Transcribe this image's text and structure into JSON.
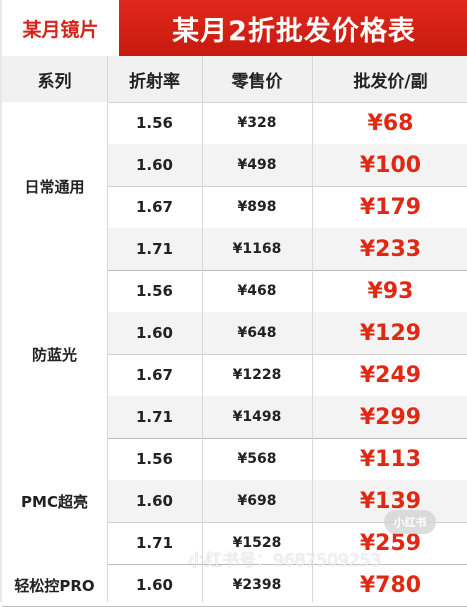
{
  "header": {
    "brand": "某月镜片",
    "title": "某月2折批发价格表"
  },
  "columns": {
    "series": "系列",
    "index": "折射率",
    "retail": "零售价",
    "wholesale": "批发价/副"
  },
  "groups": [
    {
      "name": "日常通用",
      "rows": [
        {
          "index": "1.56",
          "retail": "¥328",
          "wholesale": "¥68"
        },
        {
          "index": "1.60",
          "retail": "¥498",
          "wholesale": "¥100"
        },
        {
          "index": "1.67",
          "retail": "¥898",
          "wholesale": "¥179"
        },
        {
          "index": "1.71",
          "retail": "¥1168",
          "wholesale": "¥233"
        }
      ]
    },
    {
      "name": "防蓝光",
      "rows": [
        {
          "index": "1.56",
          "retail": "¥468",
          "wholesale": "¥93"
        },
        {
          "index": "1.60",
          "retail": "¥648",
          "wholesale": "¥129"
        },
        {
          "index": "1.67",
          "retail": "¥1228",
          "wholesale": "¥249"
        },
        {
          "index": "1.71",
          "retail": "¥1498",
          "wholesale": "¥299"
        }
      ]
    },
    {
      "name": "PMC超亮",
      "rows": [
        {
          "index": "1.56",
          "retail": "¥568",
          "wholesale": "¥113"
        },
        {
          "index": "1.60",
          "retail": "¥698",
          "wholesale": "¥139"
        },
        {
          "index": "1.71",
          "retail": "¥1528",
          "wholesale": "¥259"
        }
      ]
    },
    {
      "name": "轻松控PRO",
      "rows": [
        {
          "index": "1.60",
          "retail": "¥2398",
          "wholesale": "¥780"
        }
      ]
    }
  ],
  "watermark": {
    "text": "小红书号：9687509253",
    "logo_text": "小红书"
  }
}
